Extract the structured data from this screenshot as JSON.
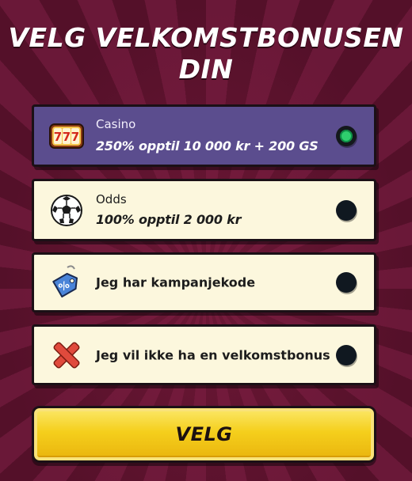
{
  "title": {
    "line1": "VELG VELKOMSTBONUSEN",
    "line2": "DIN"
  },
  "options": [
    {
      "label": "Casino",
      "value": "250% opptil 10 000 kr + 200 GS",
      "icon": "slot-777-icon",
      "selected": true
    },
    {
      "label": "Odds",
      "value": "100% opptil 2 000 kr",
      "icon": "soccer-ball-icon",
      "selected": false
    },
    {
      "label": "Jeg har kampanjekode",
      "icon": "percent-tag-icon",
      "selected": false
    },
    {
      "label": "Jeg vil ikke ha en velkomstbonus",
      "icon": "red-x-icon",
      "selected": false
    }
  ],
  "cta": {
    "label": "VELG"
  },
  "colors": {
    "background": "#5a1230",
    "option_bg": "#fcf7dd",
    "selected_bg": "#5b4d8e",
    "radio_selected": "#2fcf6e",
    "button_yellow": "#f5cf1c"
  }
}
